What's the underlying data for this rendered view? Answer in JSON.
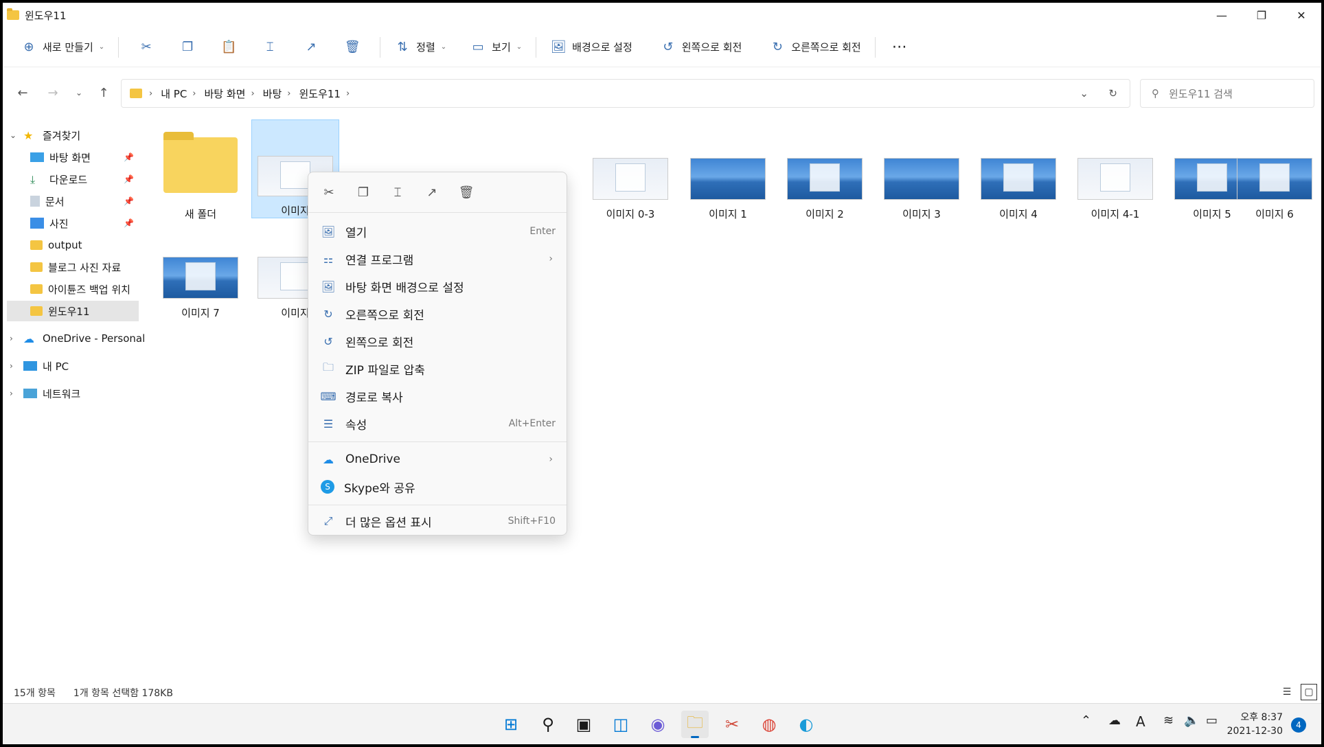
{
  "window": {
    "title": "윈도우11"
  },
  "toolbar": {
    "new_label": "새로 만들기",
    "sort_label": "정렬",
    "view_label": "보기",
    "set_bg_label": "배경으로 설정",
    "rotate_left_label": "왼쪽으로 회전",
    "rotate_right_label": "오른쪽으로 회전"
  },
  "address": {
    "crumbs": [
      "내 PC",
      "바탕 화면",
      "바탕",
      "윈도우11"
    ],
    "search_placeholder": "윈도우11 검색"
  },
  "sidebar": {
    "quick_access": "즐겨찾기",
    "items": [
      "바탕 화면",
      "다운로드",
      "문서",
      "사진",
      "output",
      "블로그 사진 자료",
      "아이튠즈 백업 위치",
      "윈도우11"
    ],
    "onedrive": "OneDrive - Personal",
    "this_pc": "내 PC",
    "network": "네트워크"
  },
  "files": [
    "새 폴더",
    "이미지",
    "이미지 0-3",
    "이미지 1",
    "이미지 2",
    "이미지 3",
    "이미지 4",
    "이미지 4-1",
    "이미지 5",
    "이미지 6",
    "이미지 7",
    "이미지"
  ],
  "context_menu": {
    "items": [
      {
        "label": "열기",
        "accel": "Enter"
      },
      {
        "label": "연결 프로그램",
        "accel": ""
      },
      {
        "label": "바탕 화면 배경으로 설정",
        "accel": ""
      },
      {
        "label": "오른쪽으로 회전",
        "accel": ""
      },
      {
        "label": "왼쪽으로 회전",
        "accel": ""
      },
      {
        "label": "ZIP 파일로 압축",
        "accel": ""
      },
      {
        "label": "경로로 복사",
        "accel": ""
      },
      {
        "label": "속성",
        "accel": "Alt+Enter"
      },
      {
        "label": "OneDrive",
        "accel": ""
      },
      {
        "label": "Skype와 공유",
        "accel": ""
      },
      {
        "label": "더 많은 옵션 표시",
        "accel": "Shift+F10"
      }
    ]
  },
  "status": {
    "count": "15개 항목",
    "selection": "1개 항목 선택함 178KB"
  },
  "taskbar": {
    "time": "오후 8:37",
    "date": "2021-12-30",
    "notifications": "4",
    "ime": "A"
  }
}
